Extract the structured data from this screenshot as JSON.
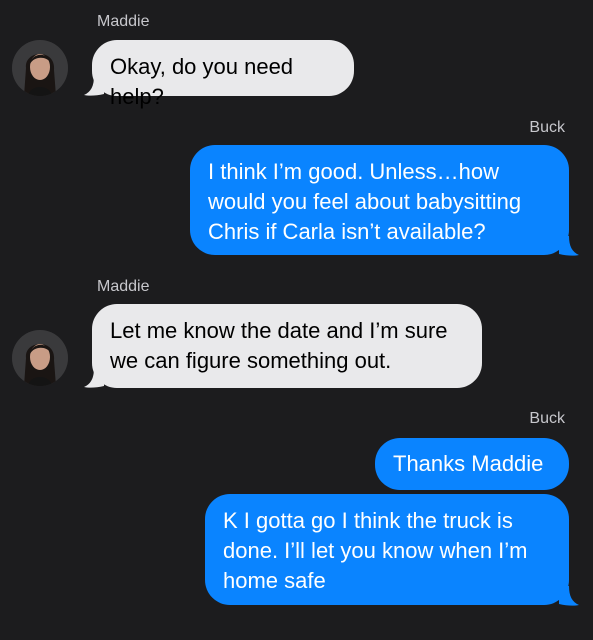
{
  "thread": {
    "messages": [
      {
        "sender": "Maddie",
        "text": "Okay, do you need help?",
        "direction": "incoming"
      },
      {
        "sender": "Buck",
        "text": "I think I’m good. Unless…how would you feel about babysitting Chris if Carla isn’t available?",
        "direction": "outgoing"
      },
      {
        "sender": "Maddie",
        "text": "Let me know the date and I’m sure we can figure something out.",
        "direction": "incoming"
      },
      {
        "sender": "Buck",
        "text": "Thanks Maddie",
        "direction": "outgoing"
      },
      {
        "sender": "Buck",
        "text": "K I gotta go I think the truck is done. I’ll let you know when I’m home safe",
        "direction": "outgoing"
      }
    ],
    "colors": {
      "background": "#1c1c1e",
      "incoming_bubble": "#e9e9eb",
      "outgoing_bubble": "#0a84ff",
      "incoming_text": "#000000",
      "outgoing_text": "#ffffff",
      "sender_label": "#c7c7cc"
    },
    "icons": {
      "avatar": "avatar-maddie"
    }
  }
}
